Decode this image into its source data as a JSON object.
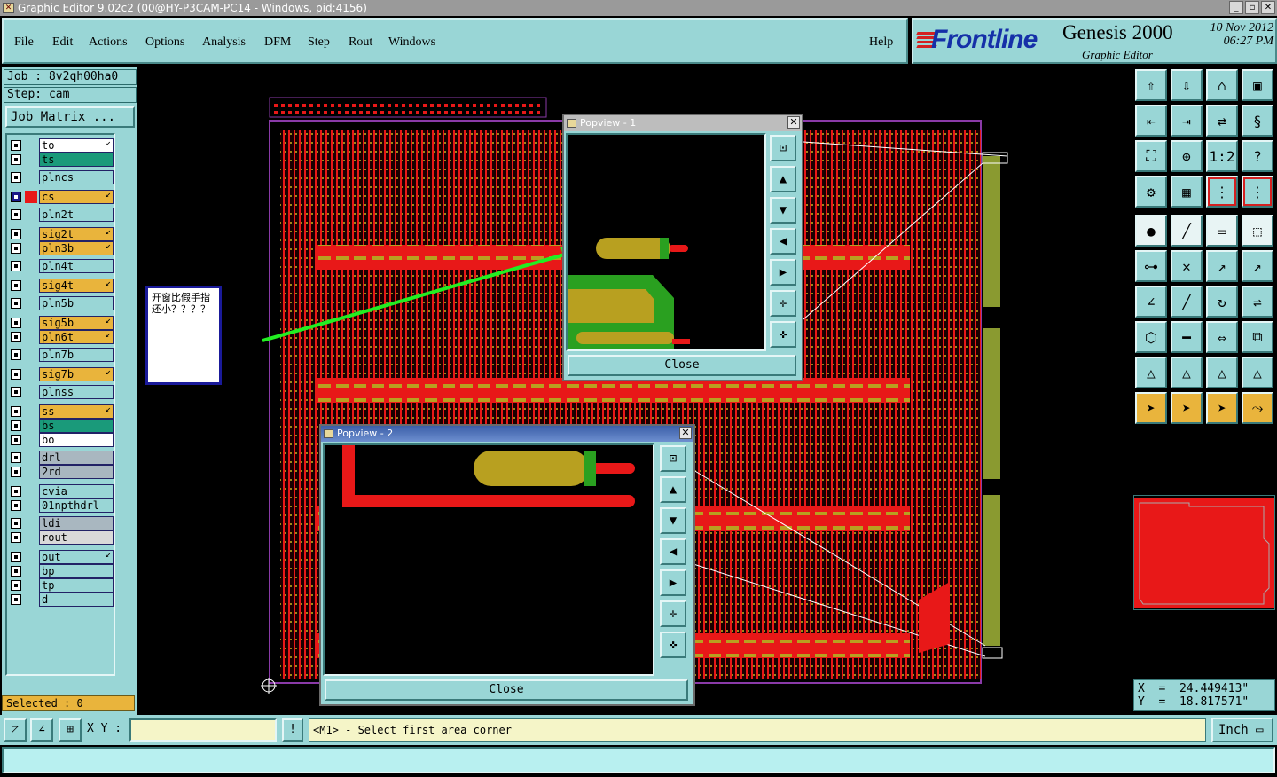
{
  "window": {
    "title": "Graphic Editor 9.02c2 (00@HY-P3CAM-PC14 - Windows, pid:4156)"
  },
  "menu": {
    "items": [
      "File",
      "Edit",
      "Actions",
      "Options",
      "Analysis",
      "DFM",
      "Step",
      "Rout",
      "Windows"
    ],
    "help": "Help"
  },
  "brand": {
    "logo": "Frontline",
    "product": "Genesis 2000",
    "subtitle": "Graphic Editor",
    "date": "10 Nov 2012",
    "time": "06:27 PM"
  },
  "job": {
    "job_label": "Job : 8v2qh00ha0",
    "step_label": "Step: cam",
    "matrix_button": "Job Matrix ..."
  },
  "layers": [
    {
      "name": "to",
      "color": "#ffffff",
      "arrow": true
    },
    {
      "name": "ts",
      "color": "#1a9a7a",
      "arrow": false
    },
    {
      "name": "plncs",
      "color": "#99d6d6",
      "arrow": false
    },
    {
      "name": "cs",
      "color": "#e9b43c",
      "arrow": true,
      "active": true,
      "swatch": "#e81818"
    },
    {
      "name": "pln2t",
      "color": "#99d6d6",
      "arrow": false
    },
    {
      "name": "sig2t",
      "color": "#e9b43c",
      "arrow": true
    },
    {
      "name": "pln3b",
      "color": "#e9b43c",
      "arrow": true
    },
    {
      "name": "pln4t",
      "color": "#99d6d6",
      "arrow": false
    },
    {
      "name": "sig4t",
      "color": "#e9b43c",
      "arrow": true
    },
    {
      "name": "pln5b",
      "color": "#99d6d6",
      "arrow": false
    },
    {
      "name": "sig5b",
      "color": "#e9b43c",
      "arrow": true
    },
    {
      "name": "pln6t",
      "color": "#e9b43c",
      "arrow": true
    },
    {
      "name": "pln7b",
      "color": "#99d6d6",
      "arrow": false
    },
    {
      "name": "sig7b",
      "color": "#e9b43c",
      "arrow": true
    },
    {
      "name": "plnss",
      "color": "#99d6d6",
      "arrow": false
    },
    {
      "name": "ss",
      "color": "#e9b43c",
      "arrow": true
    },
    {
      "name": "bs",
      "color": "#1a9a7a",
      "arrow": false
    },
    {
      "name": "bo",
      "color": "#ffffff",
      "arrow": false
    },
    {
      "name": "drl",
      "color": "#a9b7c0",
      "arrow": false
    },
    {
      "name": "2rd",
      "color": "#a9b7c0",
      "arrow": false
    },
    {
      "name": "cvia",
      "color": "#99d6d6",
      "arrow": false
    },
    {
      "name": "01npthdrl",
      "color": "#99d6d6",
      "arrow": false
    },
    {
      "name": "ldi",
      "color": "#a9b7c0",
      "arrow": false
    },
    {
      "name": "rout",
      "color": "#d9d9d9",
      "arrow": false
    },
    {
      "name": "out",
      "color": "#99d6d6",
      "arrow": true
    },
    {
      "name": "bp",
      "color": "#99d6d6",
      "arrow": false
    },
    {
      "name": "tp",
      "color": "#99d6d6",
      "arrow": false
    },
    {
      "name": "d",
      "color": "#99d6d6",
      "arrow": false
    }
  ],
  "selected": "Selected : 0",
  "note": "开窗比假手指还小？？？？",
  "popview1": {
    "title": "Popview - 1",
    "close_label": "Close"
  },
  "popview2": {
    "title": "Popview - 2",
    "close_label": "Close"
  },
  "coords": {
    "x": "X  =  24.449413\"",
    "y": "Y  =  18.817571\""
  },
  "bottom": {
    "xy_label": "X Y :",
    "xy_value": "",
    "prompt": "<M1> - Select first area corner",
    "units": "Inch"
  },
  "colors": {
    "panel": "#99d6d6",
    "trace": "#e81818",
    "pad": "#b8a020",
    "mask": "#2aa020",
    "arrow": "#22ee22"
  }
}
